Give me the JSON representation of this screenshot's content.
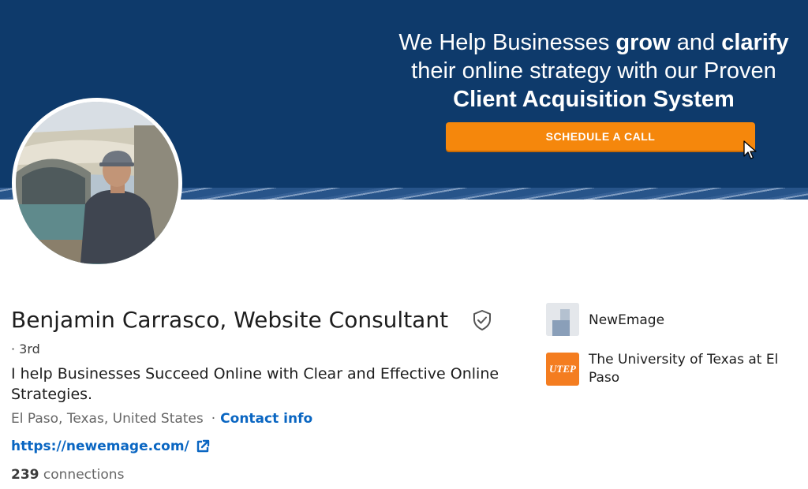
{
  "banner": {
    "headline_1a": "We Help Businesses ",
    "headline_1b": "grow",
    "headline_1c": " and ",
    "headline_1d": "clarify",
    "headline_2": "their online strategy with our Proven",
    "headline_3": "Client Acquisition System",
    "cta_label": "SCHEDULE A CALL",
    "background_color": "#0e3a6b",
    "cta_color": "#f5870c"
  },
  "profile": {
    "name": "Benjamin Carrasco, Website Consultant",
    "degree": "· 3rd",
    "headline": "I help Businesses Succeed Online with Clear and Effective Online Strategies.",
    "location": "El Paso, Texas, United States",
    "location_separator": "·",
    "contact_info_label": "Contact info",
    "website": "https://newemage.com/",
    "connections_count": "239",
    "connections_label": "connections",
    "verified_icon": "shield-check-icon"
  },
  "organizations": [
    {
      "name": "NewEmage",
      "logo": "newemage-logo"
    },
    {
      "name": "The University of Texas at El Paso",
      "logo": "utep-logo",
      "logo_text": "UTEP"
    }
  ],
  "colors": {
    "link": "#0a66c2",
    "text": "#1d1d1d",
    "muted": "#666666"
  }
}
